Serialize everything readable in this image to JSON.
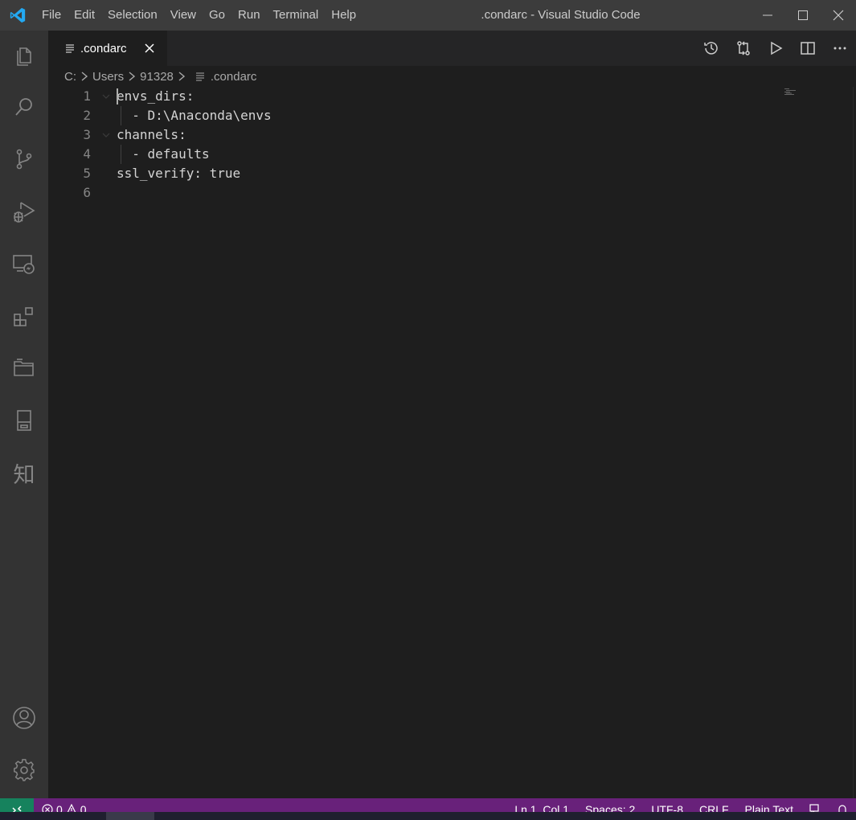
{
  "window": {
    "title": ".condarc - Visual Studio Code",
    "menu": [
      "File",
      "Edit",
      "Selection",
      "View",
      "Go",
      "Run",
      "Terminal",
      "Help"
    ]
  },
  "activity_bar": {
    "items": [
      "explorer-icon",
      "search-icon",
      "source-control-icon",
      "run-debug-icon",
      "remote-explorer-icon",
      "extensions-icon",
      "folders-icon",
      "notebook-icon",
      "zhihu-icon"
    ],
    "zhihu_glyph": "知",
    "bottom": [
      "account-icon",
      "settings-gear-icon"
    ]
  },
  "tabs": [
    {
      "label": ".condarc",
      "active": true
    }
  ],
  "editor_actions": [
    "timeline-icon",
    "compare-icon",
    "run-icon",
    "split-editor-icon",
    "more-actions-icon"
  ],
  "breadcrumb": {
    "parts": [
      "C:",
      "Users",
      "91328"
    ],
    "file": ".condarc"
  },
  "editor": {
    "lines": [
      {
        "number": "1",
        "text": "envs_dirs:"
      },
      {
        "number": "2",
        "text": "  - D:\\Anaconda\\envs"
      },
      {
        "number": "3",
        "text": "channels:"
      },
      {
        "number": "4",
        "text": "  - defaults"
      },
      {
        "number": "5",
        "text": "ssl_verify: true"
      },
      {
        "number": "6",
        "text": ""
      }
    ]
  },
  "status_bar": {
    "errors": "0",
    "warnings": "0",
    "position": "Ln 1, Col 1",
    "spaces": "Spaces: 2",
    "encoding": "UTF-8",
    "eol": "CRLF",
    "language": "Plain Text"
  },
  "colors": {
    "titlebar": "#3c3c3c",
    "activitybar": "#333333",
    "editor_bg": "#1e1e1e",
    "statusbar": "#68217a",
    "remote": "#16825d",
    "vscode_blue": "#23a9f2"
  }
}
